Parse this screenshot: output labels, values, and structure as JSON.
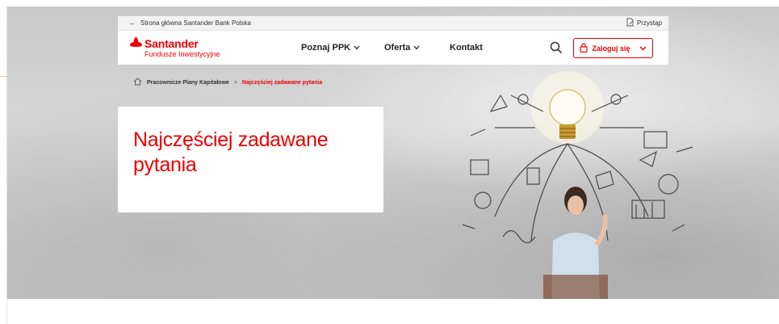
{
  "topbar": {
    "back_arrow": "←",
    "back_label": "Strona główna Santander Bank Polska",
    "join_label": "Przystąp"
  },
  "logo": {
    "name": "Santander",
    "subtitle": "Fundusze Inwestycyjne"
  },
  "nav": {
    "item1": "Poznaj PPK",
    "item2": "Oferta",
    "item3": "Kontakt"
  },
  "login": {
    "label": "Zaloguj się"
  },
  "breadcrumb": {
    "parent": "Pracownicze Plany Kapitałowe",
    "separator": ">",
    "current": "Najczęściej zadawane pytania"
  },
  "hero": {
    "title": "Najczęściej zadawane pytania"
  },
  "colors": {
    "brand_red": "#ec0000",
    "hero_background": "#cfcfcf"
  },
  "icons": [
    "arrow-left-icon",
    "join-document-icon",
    "santander-flame-icon",
    "chevron-down-icon",
    "search-icon",
    "lock-icon",
    "home-icon",
    "lightbulb-icon"
  ]
}
